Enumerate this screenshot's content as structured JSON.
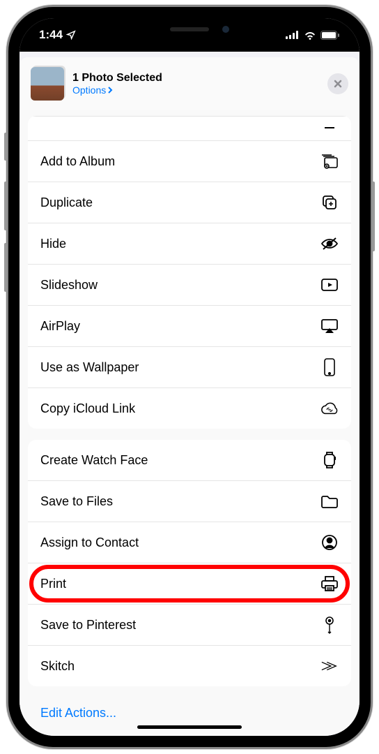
{
  "status": {
    "time": "1:44",
    "location_arrow": "➤"
  },
  "header": {
    "title": "1 Photo Selected",
    "options": "Options"
  },
  "groups": [
    {
      "items": [
        {
          "label": "Add to Album",
          "icon": "add-album-icon"
        },
        {
          "label": "Duplicate",
          "icon": "duplicate-icon"
        },
        {
          "label": "Hide",
          "icon": "hide-icon"
        },
        {
          "label": "Slideshow",
          "icon": "slideshow-icon"
        },
        {
          "label": "AirPlay",
          "icon": "airplay-icon"
        },
        {
          "label": "Use as Wallpaper",
          "icon": "wallpaper-icon"
        },
        {
          "label": "Copy iCloud Link",
          "icon": "icloud-link-icon"
        }
      ]
    },
    {
      "items": [
        {
          "label": "Create Watch Face",
          "icon": "watch-icon"
        },
        {
          "label": "Save to Files",
          "icon": "files-icon"
        },
        {
          "label": "Assign to Contact",
          "icon": "contact-icon"
        },
        {
          "label": "Print",
          "icon": "print-icon",
          "highlighted": true
        },
        {
          "label": "Save to Pinterest",
          "icon": "pinterest-icon"
        },
        {
          "label": "Skitch",
          "icon": "skitch-icon"
        }
      ]
    }
  ],
  "edit_actions": "Edit Actions..."
}
